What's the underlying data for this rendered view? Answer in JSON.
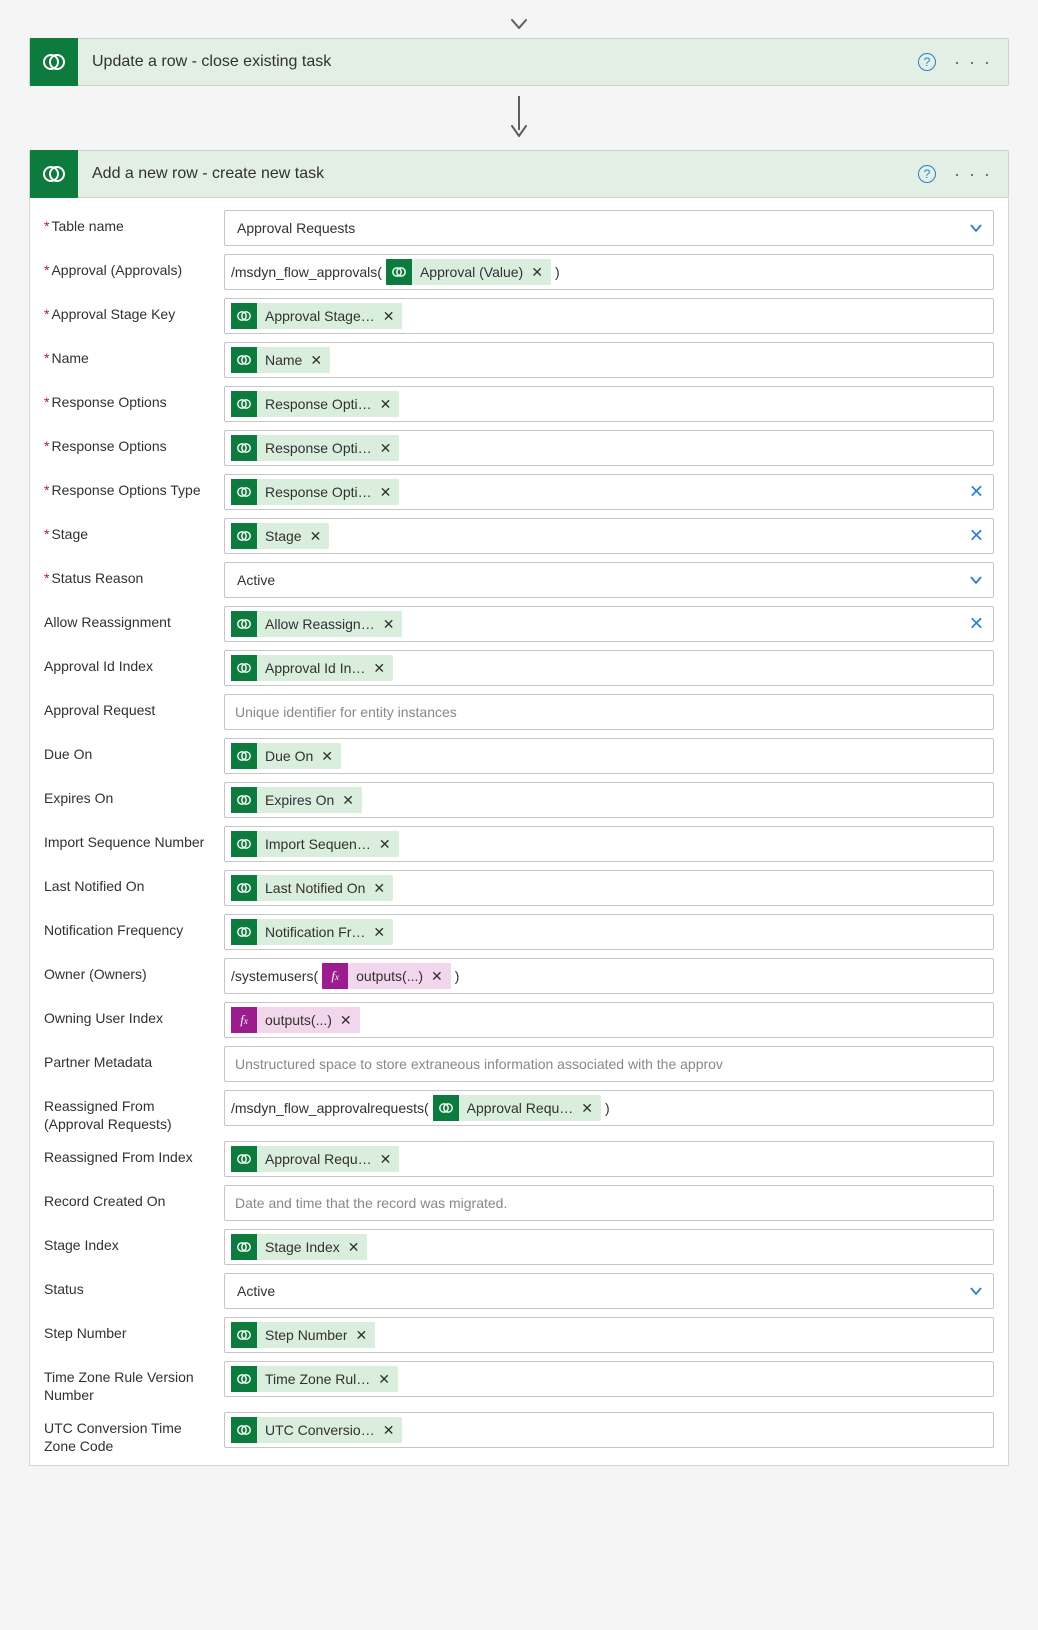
{
  "arrow_top": true,
  "step1": {
    "title": "Update a row - close existing task"
  },
  "step2": {
    "title": "Add a new row - create new task",
    "tableName": {
      "label": "Table name",
      "value": "Approval Requests"
    },
    "rows": [
      {
        "key": "approval",
        "required": true,
        "label": "Approval (Approvals)",
        "type": "composite",
        "prefix": "/msdyn_flow_approvals(",
        "token": {
          "kind": "dv",
          "text": "Approval (Value)"
        },
        "suffix": ")"
      },
      {
        "key": "approvalStageKey",
        "required": true,
        "label": "Approval Stage Key",
        "type": "token",
        "token": {
          "kind": "dv",
          "text": "Approval Stage…"
        }
      },
      {
        "key": "name",
        "required": true,
        "label": "Name",
        "type": "token",
        "token": {
          "kind": "dv",
          "text": "Name"
        }
      },
      {
        "key": "respOpt1",
        "required": true,
        "label": "Response Options",
        "type": "token",
        "token": {
          "kind": "dv",
          "text": "Response Opti…"
        }
      },
      {
        "key": "respOpt2",
        "required": true,
        "label": "Response Options",
        "type": "token",
        "token": {
          "kind": "dv",
          "text": "Response Opti…"
        }
      },
      {
        "key": "respOptType",
        "required": true,
        "label": "Response Options Type",
        "type": "token",
        "clear": true,
        "token": {
          "kind": "dv",
          "text": "Response Opti…"
        }
      },
      {
        "key": "stage",
        "required": true,
        "label": "Stage",
        "type": "token",
        "clear": true,
        "token": {
          "kind": "dv",
          "text": "Stage"
        }
      },
      {
        "key": "statusReason",
        "required": true,
        "label": "Status Reason",
        "type": "select",
        "value": "Active"
      },
      {
        "key": "allowReassign",
        "required": false,
        "label": "Allow Reassignment",
        "type": "token",
        "clear": true,
        "token": {
          "kind": "dv",
          "text": "Allow Reassign…"
        }
      },
      {
        "key": "approvalIdIndex",
        "required": false,
        "label": "Approval Id Index",
        "type": "token",
        "token": {
          "kind": "dv",
          "text": "Approval Id In…"
        }
      },
      {
        "key": "approvalRequest",
        "required": false,
        "label": "Approval Request",
        "type": "placeholder",
        "placeholder": "Unique identifier for entity instances"
      },
      {
        "key": "dueOn",
        "required": false,
        "label": "Due On",
        "type": "token",
        "token": {
          "kind": "dv",
          "text": "Due On"
        }
      },
      {
        "key": "expiresOn",
        "required": false,
        "label": "Expires On",
        "type": "token",
        "token": {
          "kind": "dv",
          "text": "Expires On"
        }
      },
      {
        "key": "importSeq",
        "required": false,
        "label": "Import Sequence Number",
        "type": "token",
        "token": {
          "kind": "dv",
          "text": "Import Sequen…"
        }
      },
      {
        "key": "lastNotified",
        "required": false,
        "label": "Last Notified On",
        "type": "token",
        "token": {
          "kind": "dv",
          "text": "Last Notified On"
        }
      },
      {
        "key": "notifFreq",
        "required": false,
        "label": "Notification Frequency",
        "type": "token",
        "token": {
          "kind": "dv",
          "text": "Notification Fr…"
        }
      },
      {
        "key": "owner",
        "required": false,
        "label": "Owner (Owners)",
        "type": "composite",
        "prefix": "/systemusers(",
        "token": {
          "kind": "fx",
          "text": "outputs(...)"
        },
        "suffix": ")"
      },
      {
        "key": "owningUser",
        "required": false,
        "label": "Owning User Index",
        "type": "token",
        "token": {
          "kind": "fx",
          "text": "outputs(...)"
        }
      },
      {
        "key": "partnerMeta",
        "required": false,
        "label": "Partner Metadata",
        "type": "placeholder",
        "placeholder": "Unstructured space to store extraneous information associated with the approv"
      },
      {
        "key": "reassignedFrom",
        "required": false,
        "label": "Reassigned From (Approval Requests)",
        "type": "composite",
        "prefix": "/msdyn_flow_approvalrequests(",
        "token": {
          "kind": "dv",
          "text": "Approval Requ…"
        },
        "suffix": ")"
      },
      {
        "key": "reassignedFromIdx",
        "required": false,
        "label": "Reassigned From Index",
        "type": "token",
        "token": {
          "kind": "dv",
          "text": "Approval Requ…"
        }
      },
      {
        "key": "recordCreated",
        "required": false,
        "label": "Record Created On",
        "type": "placeholder",
        "placeholder": "Date and time that the record was migrated."
      },
      {
        "key": "stageIndex",
        "required": false,
        "label": "Stage Index",
        "type": "token",
        "token": {
          "kind": "dv",
          "text": "Stage Index"
        }
      },
      {
        "key": "status",
        "required": false,
        "label": "Status",
        "type": "select",
        "value": "Active"
      },
      {
        "key": "stepNumber",
        "required": false,
        "label": "Step Number",
        "type": "token",
        "token": {
          "kind": "dv",
          "text": "Step Number"
        }
      },
      {
        "key": "tzRule",
        "required": false,
        "label": "Time Zone Rule Version Number",
        "type": "token",
        "token": {
          "kind": "dv",
          "text": "Time Zone Rul…"
        }
      },
      {
        "key": "utcConv",
        "required": false,
        "label": "UTC Conversion Time Zone Code",
        "type": "token",
        "token": {
          "kind": "dv",
          "text": "UTC Conversio…"
        }
      }
    ]
  }
}
